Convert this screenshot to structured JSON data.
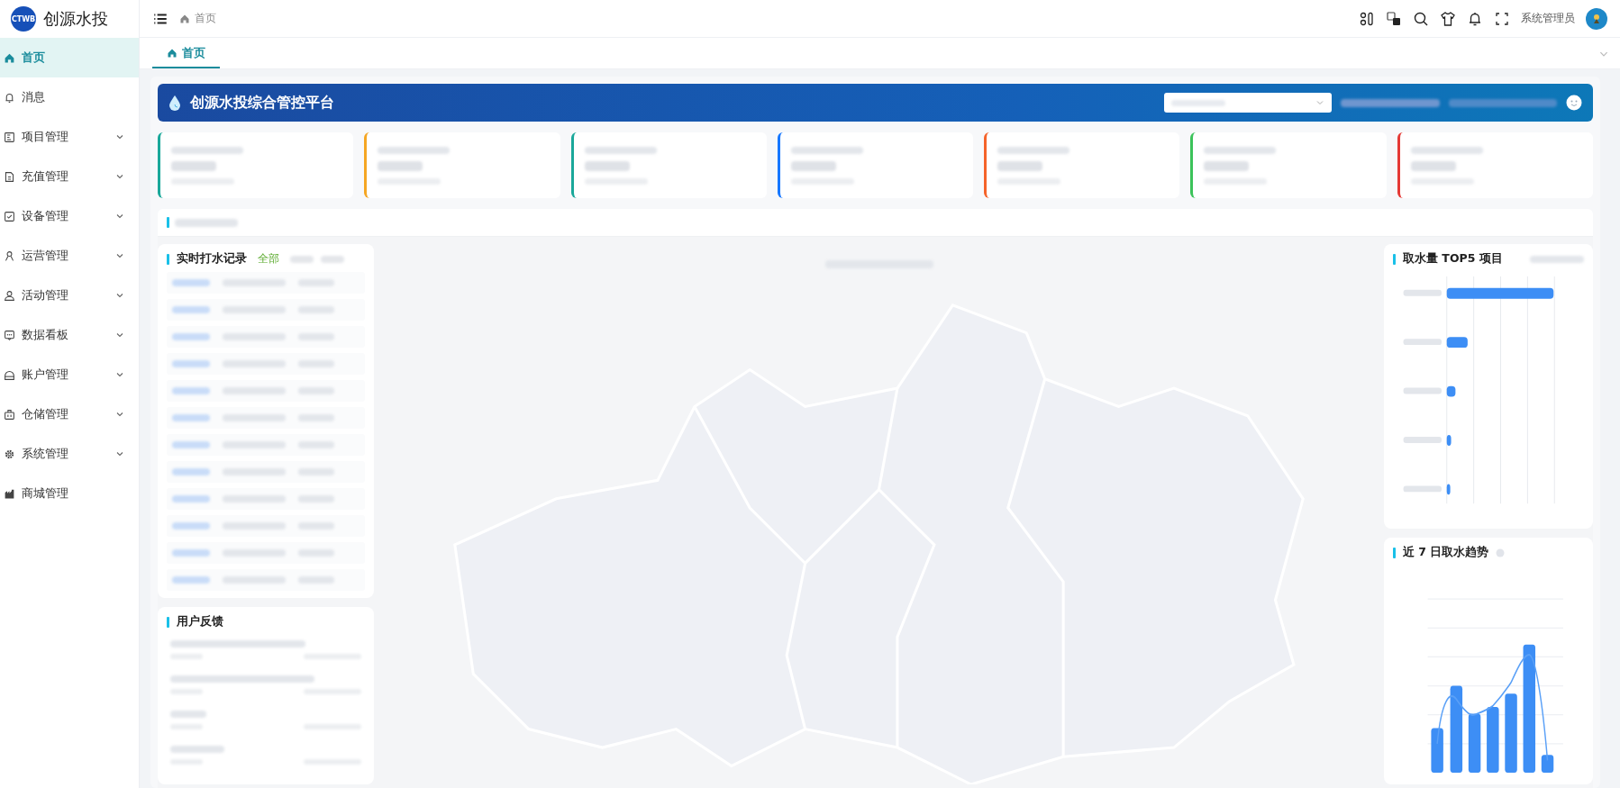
{
  "brand": {
    "name": "创源水投",
    "logo_text": "CTWB"
  },
  "sidebar": {
    "items": [
      {
        "label": "首页",
        "selected": true,
        "expandable": false
      },
      {
        "label": "消息",
        "selected": false,
        "expandable": false
      },
      {
        "label": "项目管理",
        "selected": false,
        "expandable": true
      },
      {
        "label": "充值管理",
        "selected": false,
        "expandable": true
      },
      {
        "label": "设备管理",
        "selected": false,
        "expandable": true
      },
      {
        "label": "运营管理",
        "selected": false,
        "expandable": true
      },
      {
        "label": "活动管理",
        "selected": false,
        "expandable": true
      },
      {
        "label": "数据看板",
        "selected": false,
        "expandable": true
      },
      {
        "label": "账户管理",
        "selected": false,
        "expandable": true
      },
      {
        "label": "仓储管理",
        "selected": false,
        "expandable": true
      },
      {
        "label": "系统管理",
        "selected": false,
        "expandable": true
      },
      {
        "label": "商城管理",
        "selected": false,
        "expandable": false
      }
    ]
  },
  "header": {
    "breadcrumb": "首页",
    "user": "系统管理员"
  },
  "tabs": [
    {
      "label": "首页",
      "selected": true
    }
  ],
  "banner": {
    "title": "创源水投综合管控平台"
  },
  "stat_cards": [
    {
      "color": "#1aa89a"
    },
    {
      "color": "#f5a623"
    },
    {
      "color": "#1aa89a"
    },
    {
      "color": "#1677ff"
    },
    {
      "color": "#f5632a"
    },
    {
      "color": "#3cc35a"
    },
    {
      "color": "#e53935"
    }
  ],
  "records_panel": {
    "title": "实时打水记录",
    "filters": [
      {
        "label": "全部",
        "selected": true
      }
    ]
  },
  "feedback_panel": {
    "title": "用户反馈"
  },
  "top5_panel": {
    "title": "取水量 TOP5 项目"
  },
  "trend_panel": {
    "title": "近 7 日取水趋势"
  }
}
